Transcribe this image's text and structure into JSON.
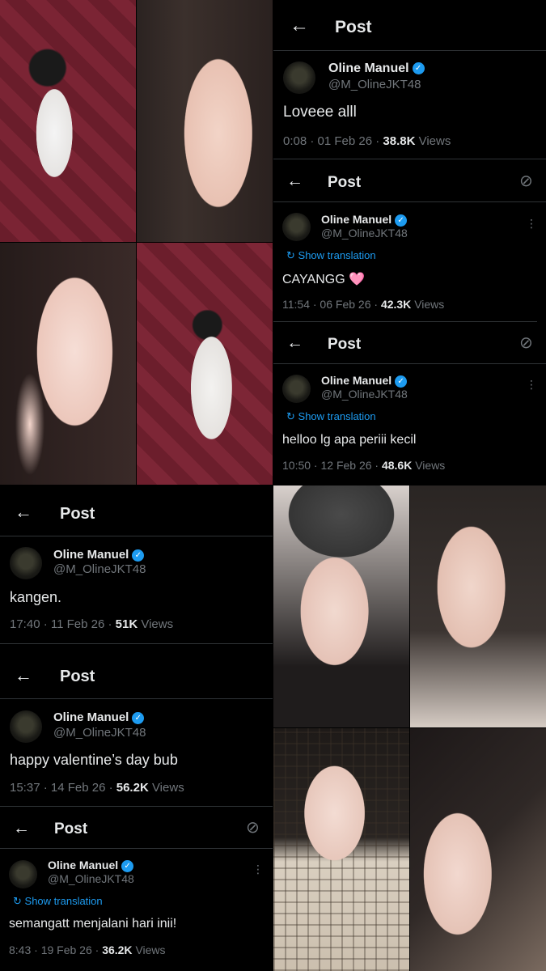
{
  "photos": [
    {
      "name": "photo-door-white-dress",
      "icon": "photo"
    },
    {
      "name": "photo-selfie-closeup",
      "icon": "photo"
    },
    {
      "name": "photo-peace-sign-selfie",
      "icon": "photo"
    },
    {
      "name": "photo-door-side-profile",
      "icon": "photo"
    },
    {
      "name": "photo-beret-glasses",
      "icon": "photo"
    },
    {
      "name": "photo-selfie-long-hair",
      "icon": "photo"
    },
    {
      "name": "photo-plaid-shirt",
      "icon": "photo"
    },
    {
      "name": "photo-closeup-eye",
      "icon": "photo"
    }
  ],
  "header": {
    "back": "←",
    "title": "Post"
  },
  "author": {
    "name": "Oline Manuel",
    "handle": "@M_OlineJKT48",
    "verified_glyph": "✓"
  },
  "translate_label": "Show translation",
  "translate_glyph": "↻",
  "grok_glyph": "⊘",
  "more_glyph": "⋮",
  "views_suffix": "Views",
  "posts": [
    {
      "text": "Loveee alll",
      "time": "0:08 · 01 Feb 26 · ",
      "views": "38.8K"
    },
    {
      "text": "CAYANGG ",
      "emoji": "🩷",
      "time": "11:54 · 06 Feb 26 · ",
      "views": "42.3K"
    },
    {
      "text": "helloo lg apa periii kecil",
      "time": "10:50 · 12 Feb 26 · ",
      "views": "48.6K"
    },
    {
      "text": "kangen.",
      "time": "17:40 · 11 Feb 26 · ",
      "views": "51K"
    },
    {
      "text": "happy valentine’s day bub",
      "time": "15:37 · 14 Feb 26 · ",
      "views": "56.2K"
    },
    {
      "text": "semangatt menjalani hari inii!",
      "time": "8:43 · 19 Feb 26 · ",
      "views": "36.2K"
    }
  ],
  "colors": {
    "background": "#000000",
    "accent": "#1d9bf0",
    "muted": "#71767b",
    "text": "#e7e9ea",
    "divider": "#2f3336"
  }
}
